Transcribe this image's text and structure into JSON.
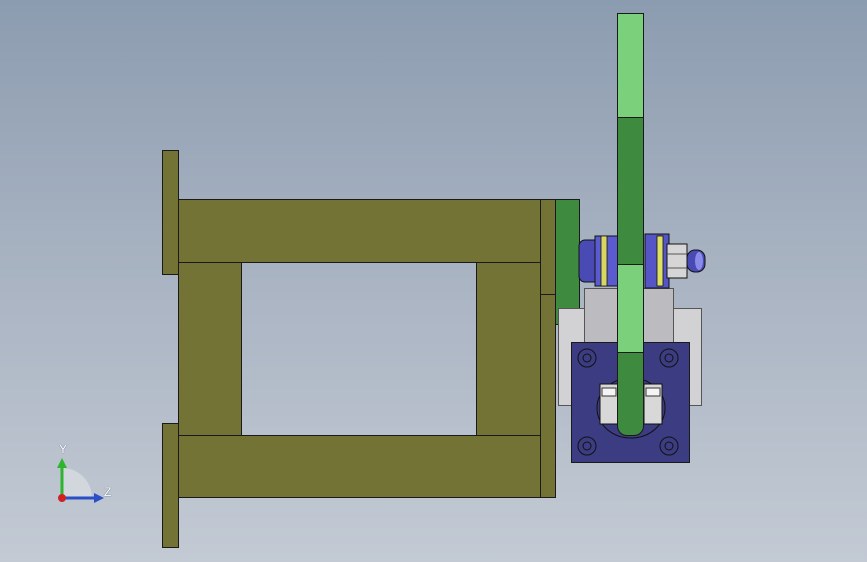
{
  "viewport": {
    "background_top": "#8c9cb0",
    "background_bottom": "#c3cad4"
  },
  "model": {
    "frame_color": "#737336",
    "lever_light_color": "#7bd07b",
    "lever_dark_color": "#3e8a3e",
    "block_color": "#3c3c82",
    "bracket_color": "#c8c8c8",
    "washer_color": "#4a4ab4"
  },
  "triad": {
    "y_label": "Y",
    "z_label": "Z",
    "y_color": "#2db52d",
    "z_color": "#2b4fc7",
    "x_color": "#d02020"
  }
}
